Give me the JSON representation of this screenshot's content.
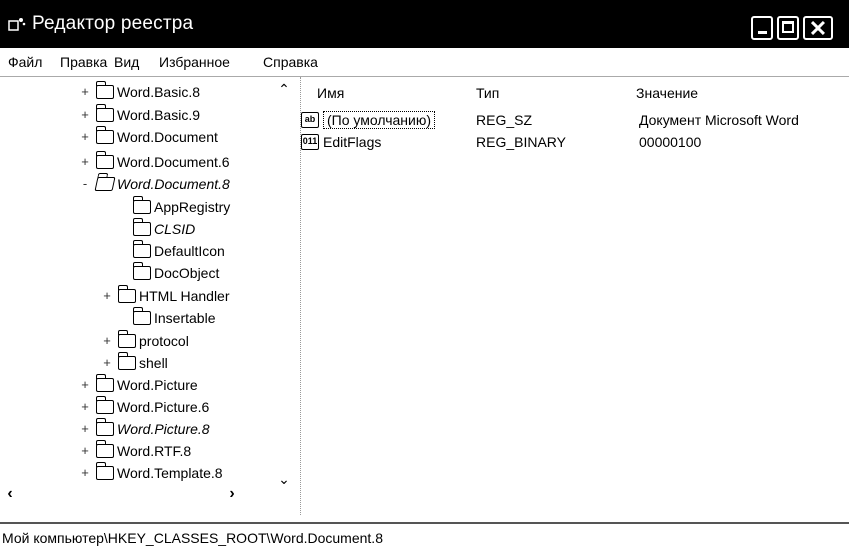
{
  "window": {
    "title": "Редактор реестра",
    "icon": "regedit-icon"
  },
  "menu": [
    "Файл",
    "Правка",
    "Вид",
    "Избранное",
    "Справка"
  ],
  "tree": {
    "items": [
      {
        "label": "Word.Basic.8",
        "expander": "+",
        "italic": false
      },
      {
        "label": "Word.Basic.9",
        "expander": "+",
        "italic": false
      },
      {
        "label": "Word.Document",
        "expander": "+",
        "italic": false
      },
      {
        "label": "Word.Document.6",
        "expander": "+",
        "italic": false
      },
      {
        "label": "Word.Document.8",
        "expander": "-",
        "italic": true,
        "selected": true
      },
      {
        "label": "AppRegistry",
        "expander": "",
        "italic": false
      },
      {
        "label": "CLSID",
        "expander": "",
        "italic": true
      },
      {
        "label": "DefaultIcon",
        "expander": "",
        "italic": false
      },
      {
        "label": "DocObject",
        "expander": "",
        "italic": false
      },
      {
        "label": "HTML Handler",
        "expander": "+",
        "italic": false
      },
      {
        "label": "Insertable",
        "expander": "",
        "italic": false
      },
      {
        "label": "protocol",
        "expander": "+",
        "italic": false
      },
      {
        "label": "shell",
        "expander": "+",
        "italic": false
      },
      {
        "label": "Word.Picture",
        "expander": "+",
        "italic": false
      },
      {
        "label": "Word.Picture.6",
        "expander": "+",
        "italic": false
      },
      {
        "label": "Word.Picture.8",
        "expander": "+",
        "italic": true
      },
      {
        "label": "Word.RTF.8",
        "expander": "+",
        "italic": false
      },
      {
        "label": "Word.Template.8",
        "expander": "+",
        "italic": false
      }
    ]
  },
  "list": {
    "columns": {
      "name": "Имя",
      "type": "Тип",
      "value": "Значение"
    },
    "rows": [
      {
        "icon": "ab",
        "name": "(По умолчанию)",
        "type": "REG_SZ",
        "value": "Документ Microsoft Word"
      },
      {
        "icon": "011",
        "name": "EditFlags",
        "type": "REG_BINARY",
        "value": "00000100"
      }
    ]
  },
  "status": {
    "path": "Мой компьютер\\HKEY_CLASSES_ROOT\\Word.Document.8"
  }
}
